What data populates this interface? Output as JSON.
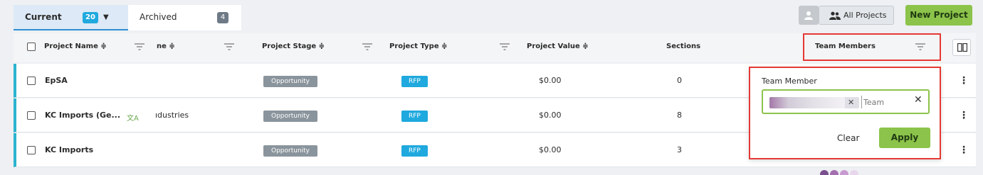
{
  "tabs": {
    "current": {
      "label": "Current",
      "count": "20"
    },
    "archived": {
      "label": "Archived",
      "count": "4"
    }
  },
  "toolbar": {
    "all_projects_label": "All Projects",
    "new_project_label": "New Project"
  },
  "table": {
    "headers": {
      "project_name": "Project Name ≑",
      "name2": "ne ≑",
      "project_stage": "Project Stage ≑",
      "project_type": "Project Type ≑",
      "project_value": "Project Value ≑",
      "sections": "Sections",
      "team_members": "Team Members"
    },
    "rows": [
      {
        "name": "EpSA",
        "col2": "",
        "stage": "Opportunity",
        "type": "RFP",
        "value": "$0.00",
        "sections": "0"
      },
      {
        "name": "KC Imports (Ge...",
        "col2": "ıdustries",
        "stage": "Opportunity",
        "type": "RFP",
        "value": "$0.00",
        "sections": "8"
      },
      {
        "name": "KC Imports",
        "col2": "",
        "stage": "Opportunity",
        "type": "RFP",
        "value": "$0.00",
        "sections": "3"
      }
    ]
  },
  "filter_popup": {
    "title": "Team Member",
    "placeholder": "Team",
    "clear_label": "Clear",
    "apply_label": "Apply"
  },
  "colors": {
    "accent_blue": "#1fa9de",
    "accent_green": "#8cc34a",
    "highlight_red": "#e53935",
    "row_border": "#2bb3cf"
  }
}
